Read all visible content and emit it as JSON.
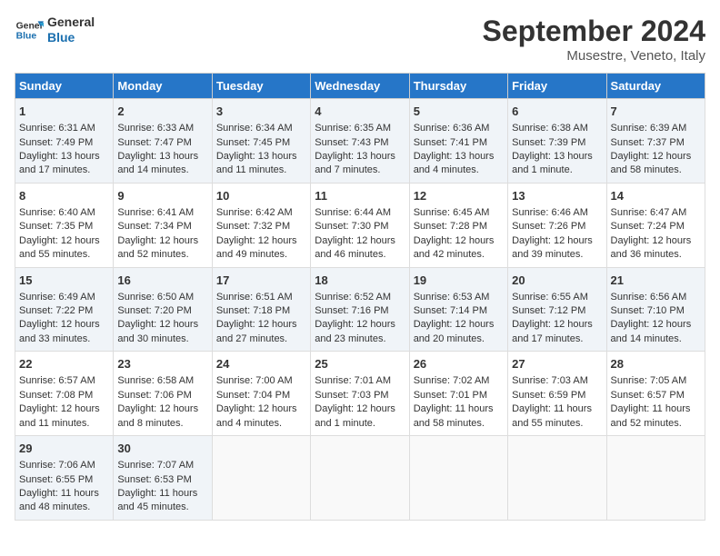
{
  "header": {
    "logo_line1": "General",
    "logo_line2": "Blue",
    "month": "September 2024",
    "location": "Musestre, Veneto, Italy"
  },
  "weekdays": [
    "Sunday",
    "Monday",
    "Tuesday",
    "Wednesday",
    "Thursday",
    "Friday",
    "Saturday"
  ],
  "weeks": [
    [
      {
        "day": "1",
        "sunrise": "Sunrise: 6:31 AM",
        "sunset": "Sunset: 7:49 PM",
        "daylight": "Daylight: 13 hours and 17 minutes."
      },
      {
        "day": "2",
        "sunrise": "Sunrise: 6:33 AM",
        "sunset": "Sunset: 7:47 PM",
        "daylight": "Daylight: 13 hours and 14 minutes."
      },
      {
        "day": "3",
        "sunrise": "Sunrise: 6:34 AM",
        "sunset": "Sunset: 7:45 PM",
        "daylight": "Daylight: 13 hours and 11 minutes."
      },
      {
        "day": "4",
        "sunrise": "Sunrise: 6:35 AM",
        "sunset": "Sunset: 7:43 PM",
        "daylight": "Daylight: 13 hours and 7 minutes."
      },
      {
        "day": "5",
        "sunrise": "Sunrise: 6:36 AM",
        "sunset": "Sunset: 7:41 PM",
        "daylight": "Daylight: 13 hours and 4 minutes."
      },
      {
        "day": "6",
        "sunrise": "Sunrise: 6:38 AM",
        "sunset": "Sunset: 7:39 PM",
        "daylight": "Daylight: 13 hours and 1 minute."
      },
      {
        "day": "7",
        "sunrise": "Sunrise: 6:39 AM",
        "sunset": "Sunset: 7:37 PM",
        "daylight": "Daylight: 12 hours and 58 minutes."
      }
    ],
    [
      {
        "day": "8",
        "sunrise": "Sunrise: 6:40 AM",
        "sunset": "Sunset: 7:35 PM",
        "daylight": "Daylight: 12 hours and 55 minutes."
      },
      {
        "day": "9",
        "sunrise": "Sunrise: 6:41 AM",
        "sunset": "Sunset: 7:34 PM",
        "daylight": "Daylight: 12 hours and 52 minutes."
      },
      {
        "day": "10",
        "sunrise": "Sunrise: 6:42 AM",
        "sunset": "Sunset: 7:32 PM",
        "daylight": "Daylight: 12 hours and 49 minutes."
      },
      {
        "day": "11",
        "sunrise": "Sunrise: 6:44 AM",
        "sunset": "Sunset: 7:30 PM",
        "daylight": "Daylight: 12 hours and 46 minutes."
      },
      {
        "day": "12",
        "sunrise": "Sunrise: 6:45 AM",
        "sunset": "Sunset: 7:28 PM",
        "daylight": "Daylight: 12 hours and 42 minutes."
      },
      {
        "day": "13",
        "sunrise": "Sunrise: 6:46 AM",
        "sunset": "Sunset: 7:26 PM",
        "daylight": "Daylight: 12 hours and 39 minutes."
      },
      {
        "day": "14",
        "sunrise": "Sunrise: 6:47 AM",
        "sunset": "Sunset: 7:24 PM",
        "daylight": "Daylight: 12 hours and 36 minutes."
      }
    ],
    [
      {
        "day": "15",
        "sunrise": "Sunrise: 6:49 AM",
        "sunset": "Sunset: 7:22 PM",
        "daylight": "Daylight: 12 hours and 33 minutes."
      },
      {
        "day": "16",
        "sunrise": "Sunrise: 6:50 AM",
        "sunset": "Sunset: 7:20 PM",
        "daylight": "Daylight: 12 hours and 30 minutes."
      },
      {
        "day": "17",
        "sunrise": "Sunrise: 6:51 AM",
        "sunset": "Sunset: 7:18 PM",
        "daylight": "Daylight: 12 hours and 27 minutes."
      },
      {
        "day": "18",
        "sunrise": "Sunrise: 6:52 AM",
        "sunset": "Sunset: 7:16 PM",
        "daylight": "Daylight: 12 hours and 23 minutes."
      },
      {
        "day": "19",
        "sunrise": "Sunrise: 6:53 AM",
        "sunset": "Sunset: 7:14 PM",
        "daylight": "Daylight: 12 hours and 20 minutes."
      },
      {
        "day": "20",
        "sunrise": "Sunrise: 6:55 AM",
        "sunset": "Sunset: 7:12 PM",
        "daylight": "Daylight: 12 hours and 17 minutes."
      },
      {
        "day": "21",
        "sunrise": "Sunrise: 6:56 AM",
        "sunset": "Sunset: 7:10 PM",
        "daylight": "Daylight: 12 hours and 14 minutes."
      }
    ],
    [
      {
        "day": "22",
        "sunrise": "Sunrise: 6:57 AM",
        "sunset": "Sunset: 7:08 PM",
        "daylight": "Daylight: 12 hours and 11 minutes."
      },
      {
        "day": "23",
        "sunrise": "Sunrise: 6:58 AM",
        "sunset": "Sunset: 7:06 PM",
        "daylight": "Daylight: 12 hours and 8 minutes."
      },
      {
        "day": "24",
        "sunrise": "Sunrise: 7:00 AM",
        "sunset": "Sunset: 7:04 PM",
        "daylight": "Daylight: 12 hours and 4 minutes."
      },
      {
        "day": "25",
        "sunrise": "Sunrise: 7:01 AM",
        "sunset": "Sunset: 7:03 PM",
        "daylight": "Daylight: 12 hours and 1 minute."
      },
      {
        "day": "26",
        "sunrise": "Sunrise: 7:02 AM",
        "sunset": "Sunset: 7:01 PM",
        "daylight": "Daylight: 11 hours and 58 minutes."
      },
      {
        "day": "27",
        "sunrise": "Sunrise: 7:03 AM",
        "sunset": "Sunset: 6:59 PM",
        "daylight": "Daylight: 11 hours and 55 minutes."
      },
      {
        "day": "28",
        "sunrise": "Sunrise: 7:05 AM",
        "sunset": "Sunset: 6:57 PM",
        "daylight": "Daylight: 11 hours and 52 minutes."
      }
    ],
    [
      {
        "day": "29",
        "sunrise": "Sunrise: 7:06 AM",
        "sunset": "Sunset: 6:55 PM",
        "daylight": "Daylight: 11 hours and 48 minutes."
      },
      {
        "day": "30",
        "sunrise": "Sunrise: 7:07 AM",
        "sunset": "Sunset: 6:53 PM",
        "daylight": "Daylight: 11 hours and 45 minutes."
      },
      null,
      null,
      null,
      null,
      null
    ]
  ]
}
